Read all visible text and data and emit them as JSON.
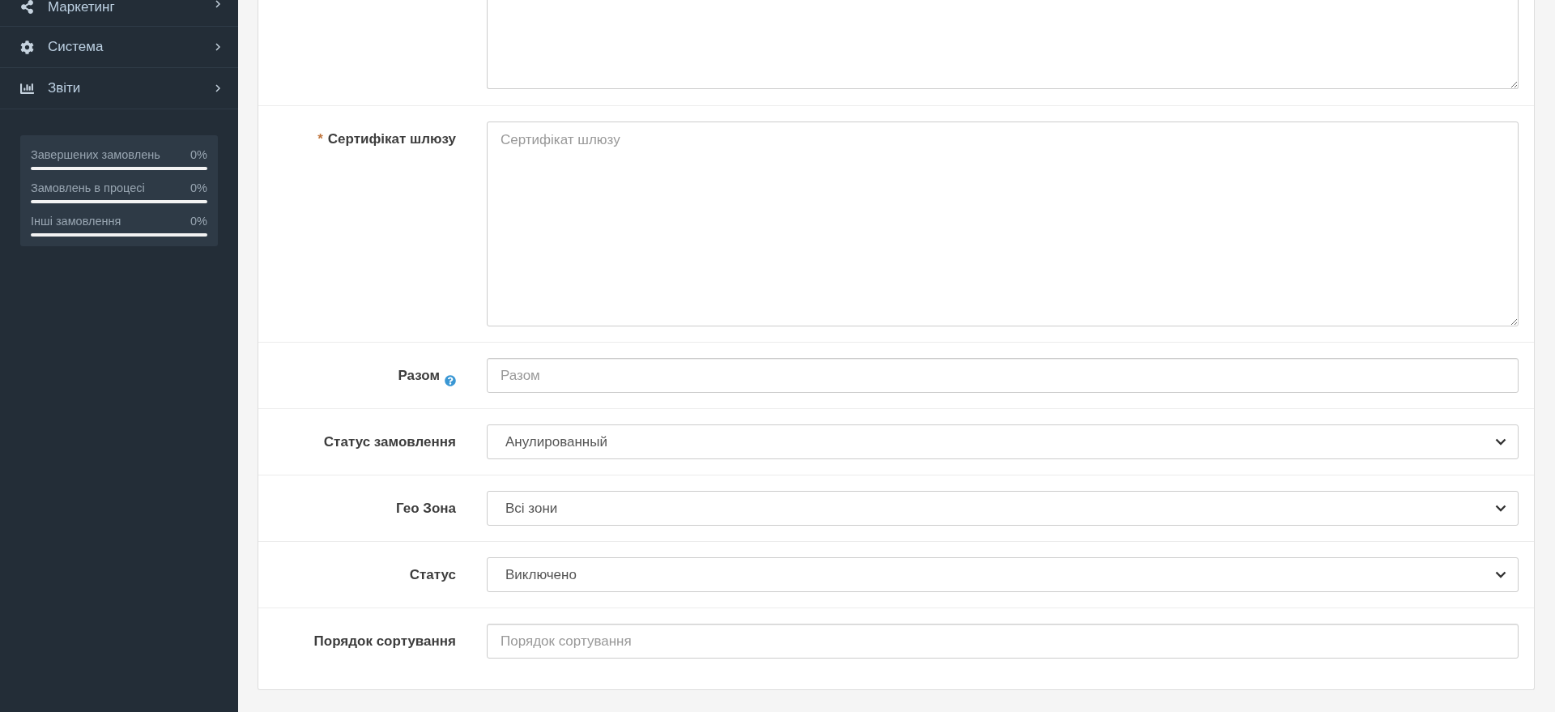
{
  "sidebar": {
    "menu": [
      {
        "label": "Маркетинг",
        "expanded": false
      },
      {
        "label": "Система",
        "expanded": false
      },
      {
        "label": "Звіти",
        "expanded": false
      }
    ],
    "stats": [
      {
        "label": "Завершених замовлень",
        "value": "0%"
      },
      {
        "label": "Замовлень в процесі",
        "value": "0%"
      },
      {
        "label": "Інші замовлення",
        "value": "0%"
      }
    ]
  },
  "form": {
    "fields": [
      {
        "kind": "textarea"
      },
      {
        "kind": "textarea",
        "required_mark": "*",
        "label": "Сертифікат шлюзу",
        "placeholder": "Сертифікат шлюзу"
      },
      {
        "kind": "input",
        "label": "Разом",
        "help": true,
        "placeholder": "Разом"
      },
      {
        "kind": "select",
        "label": "Статус замовлення",
        "value": "Анулированный"
      },
      {
        "kind": "select",
        "label": "Гео Зона",
        "value": "Всі зони"
      },
      {
        "kind": "select",
        "label": "Статус",
        "value": "Виключено"
      },
      {
        "kind": "input",
        "label": "Порядок сортування",
        "placeholder": "Порядок сортування"
      }
    ]
  }
}
